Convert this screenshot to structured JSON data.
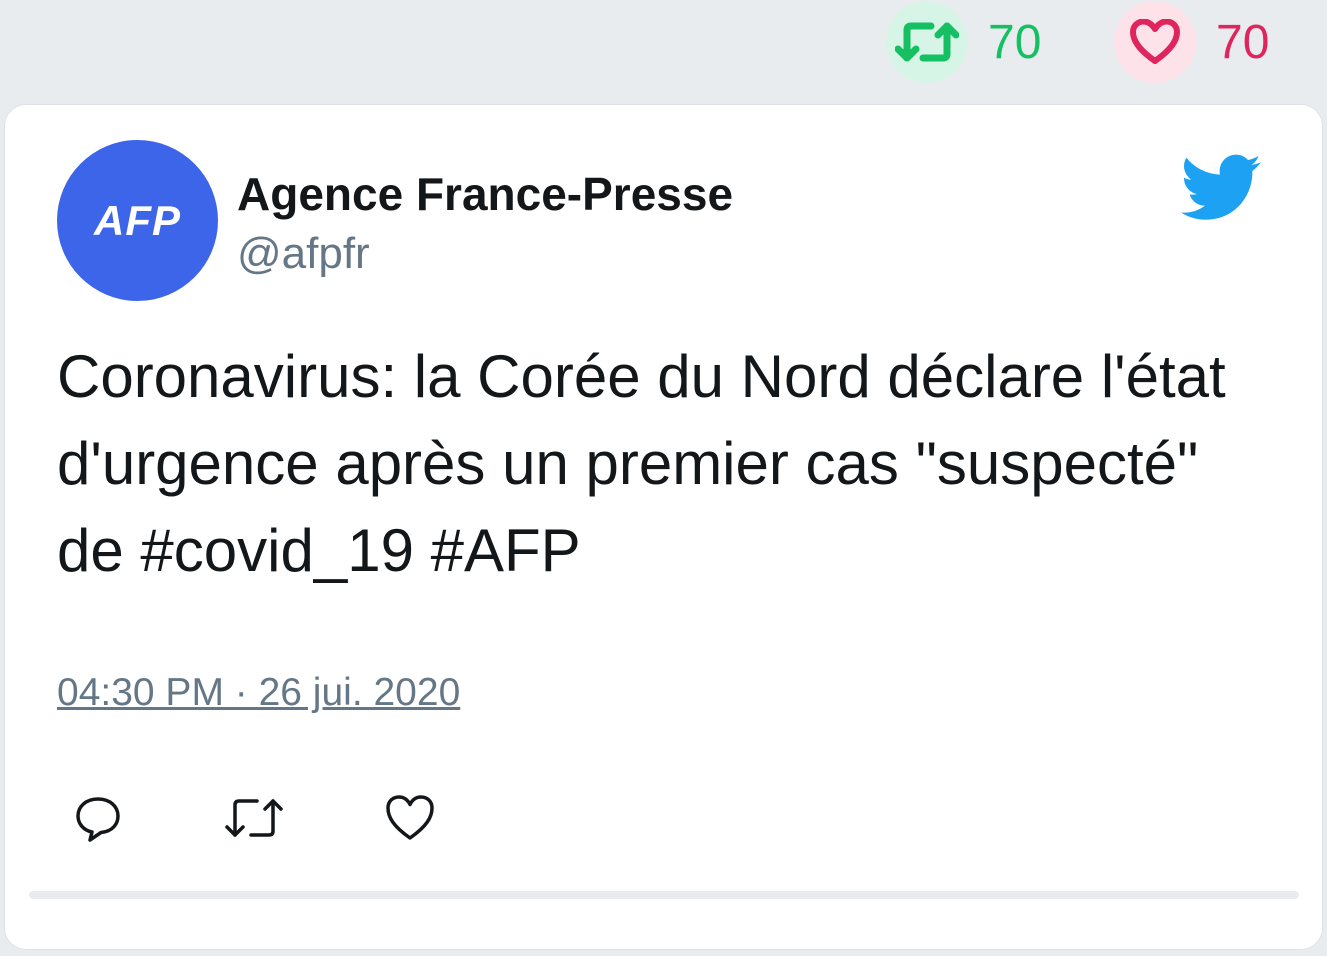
{
  "top_stats": {
    "retweet_count": "70",
    "like_count": "70"
  },
  "tweet": {
    "avatar_text": "AFP",
    "display_name": "Agence France-Presse",
    "handle": "@afpfr",
    "text": "Coronavirus: la Corée du Nord déclare l'état d'urgence après un premier cas \"suspecté\" de #covid_19 #AFP",
    "timestamp": "04:30 PM · 26 jui. 2020"
  },
  "icons": {
    "top_retweet": "retweet-icon",
    "top_like": "heart-icon",
    "platform": "twitter-bird-icon",
    "reply": "reply-icon",
    "retweet": "retweet-icon",
    "like": "heart-icon"
  },
  "colors": {
    "retweet_green": "#17bf63",
    "like_red": "#e0245e",
    "twitter_blue": "#1da1f2",
    "avatar_blue": "#3d65ea",
    "secondary_text": "#657786"
  }
}
